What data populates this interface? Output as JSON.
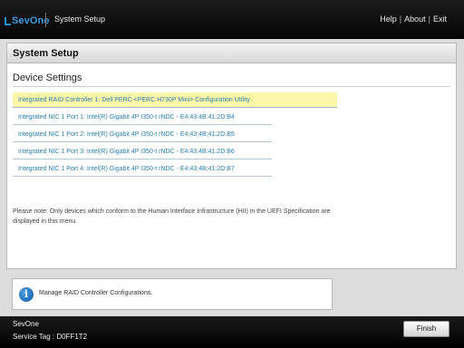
{
  "header": {
    "logo_text": "SevOne",
    "app_title": "System Setup",
    "links": {
      "help": "Help",
      "about": "About",
      "exit": "Exit"
    },
    "separator": "|"
  },
  "page": {
    "title": "System Setup",
    "section_title": "Device Settings",
    "devices": [
      "Integrated RAID Controller 1: Dell PERC <PERC H730P Mini> Configuration Utility",
      "Integrated NIC 1 Port 1: Intel(R) Gigabit 4P I350-t rNDC - E4:43:4B:41:2D:B4",
      "Integrated NIC 1 Port 2: Intel(R) Gigabit 4P I350-t rNDC - E4:43:4B:41:2D:B5",
      "Integrated NIC 1 Port 3: Intel(R) Gigabit 4P I350-t rNDC - E4:43:4B:41:2D:B6",
      "Integrated NIC 1 Port 4: Intel(R) Gigabit 4P I350-t rNDC - E4:43:4B:41:2D:B7"
    ],
    "note": "Please note: Only devices which conform to the Human Interface Infrastructure (HII) in the UEFI Specification are displayed in this menu."
  },
  "help": {
    "icon": "info-icon",
    "text": "Manage RAID Controller Configurations."
  },
  "footer": {
    "system_name": "SevOne",
    "service_tag": "Service Tag : D0FF1T2",
    "finish_label": "Finish"
  },
  "colors": {
    "link": "#2b7fb4",
    "selected_bg": "#fbf7a8",
    "brand": "#3a9be0"
  }
}
